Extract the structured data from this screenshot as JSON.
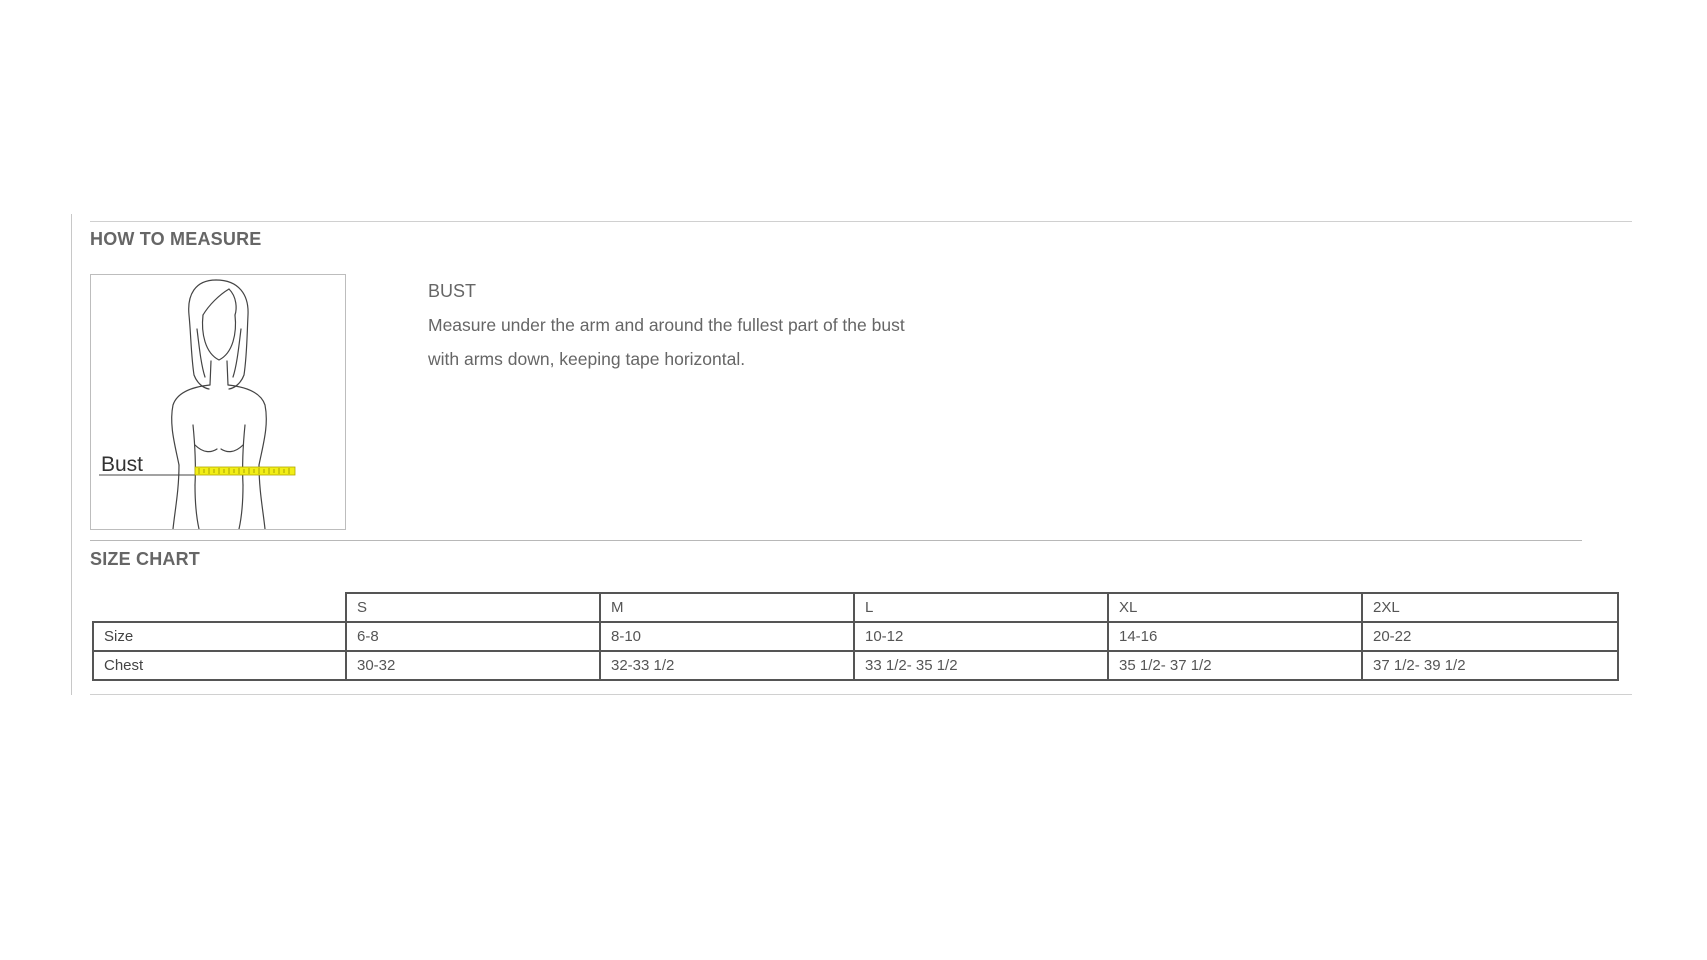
{
  "how_to_measure": {
    "title": "HOW TO MEASURE",
    "illustration_label": "Bust",
    "heading": "BUST",
    "instructions": [
      "Measure under the arm and around the fullest part of the bust",
      "with arms down, keeping tape horizontal."
    ]
  },
  "size_chart": {
    "title": "SIZE CHART",
    "columns": [
      "S",
      "M",
      "L",
      "XL",
      "2XL"
    ],
    "rows": [
      {
        "label": "Size",
        "values": [
          "6-8",
          "8-10",
          "10-12",
          "14-16",
          "20-22"
        ]
      },
      {
        "label": "Chest",
        "values": [
          "30-32",
          "32-33 1/2",
          "33 1/2- 35 1/2",
          "35 1/2- 37 1/2",
          "37 1/2- 39 1/2"
        ]
      }
    ]
  },
  "colors": {
    "tape_highlight": "#f2ee16",
    "rule": "#d0d0d0",
    "text": "#666666"
  }
}
